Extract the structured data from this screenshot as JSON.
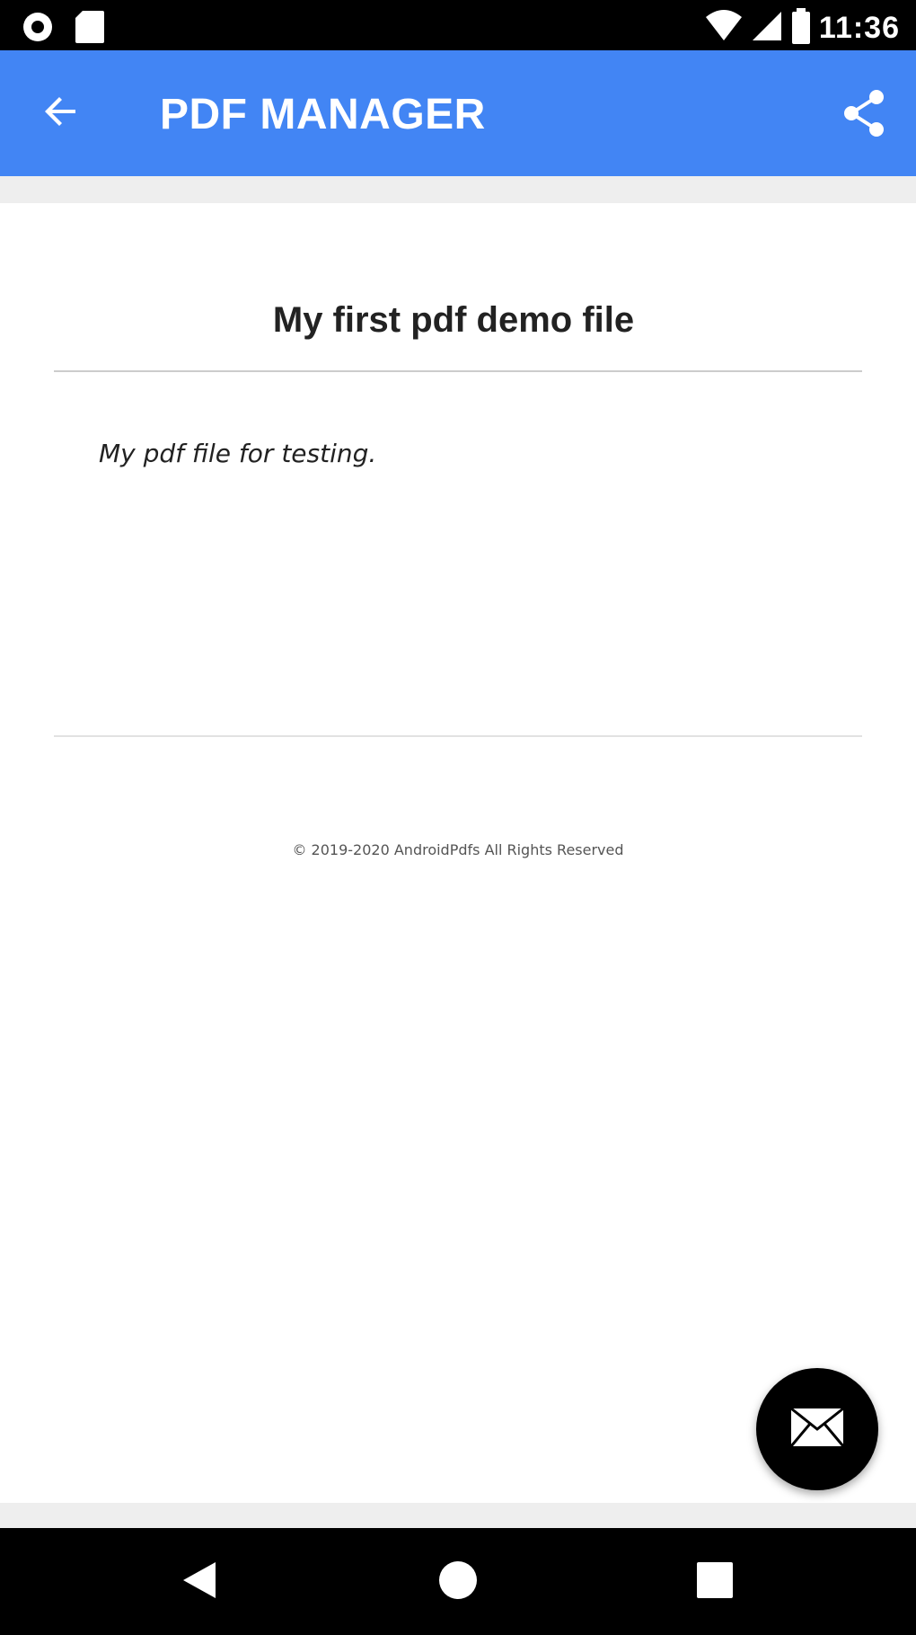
{
  "status_bar": {
    "time": "11:36",
    "left_icons": [
      "settings-gear-icon",
      "sd-card-icon"
    ],
    "right_icons": [
      "wifi-icon",
      "cell-signal-icon",
      "battery-icon"
    ]
  },
  "app_bar": {
    "title": "PDF MANAGER",
    "back_icon": "arrow-back-icon",
    "share_icon": "share-icon",
    "background_color": "#4285f4"
  },
  "document": {
    "title": "My first pdf demo file",
    "body": "My pdf file for testing.",
    "footer": "© 2019-2020 AndroidPdfs All Rights Reserved"
  },
  "fab": {
    "icon": "mail-icon",
    "background_color": "#000000"
  },
  "nav_bar": {
    "buttons": [
      "back-triangle-icon",
      "home-circle-icon",
      "recents-square-icon"
    ]
  }
}
